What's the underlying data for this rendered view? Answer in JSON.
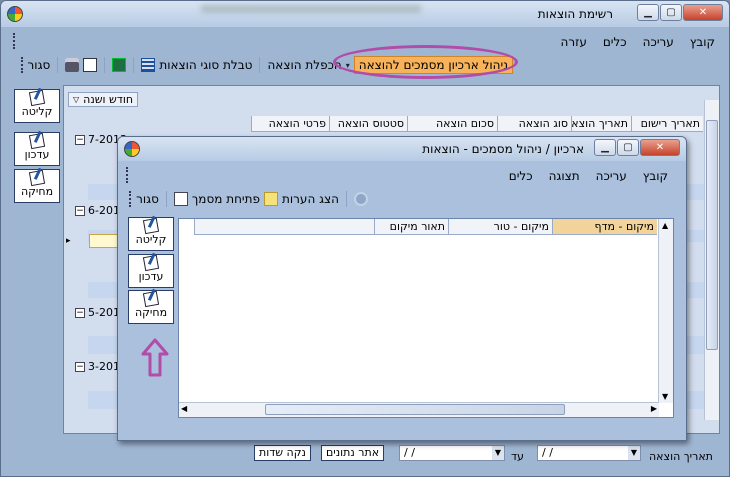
{
  "main_window": {
    "title": "רשימת הוצאות",
    "menu": [
      "קובץ",
      "עריכה",
      "כלים",
      "עזרה"
    ],
    "toolbar": {
      "archive_button": "ניהול ארכיון מסמכים להוצאה",
      "duplicate_button": "הכפלת הוצאה",
      "types_table_button": "טבלת סוגי הוצאות",
      "close_button": "סגור"
    },
    "group_by": "חודש ושנה",
    "columns": [
      "תאריך רישום",
      "תאריך הוצאה",
      "סוג הוצאה",
      "סכום הוצאה",
      "סטטוס הוצאה",
      "פרטי הוצאה"
    ],
    "groups": [
      "7-2013",
      "6-2013",
      "5-2013",
      "3-2013"
    ],
    "side_buttons": [
      "קליטה",
      "עדכון",
      "מחיקה"
    ],
    "bottom": {
      "date_label": "תאריך הוצאה",
      "to_label": "עד",
      "date_from": "/ /",
      "date_to": "/ /",
      "find_button": "אתר נתונים",
      "clear_button": "נקה שדות"
    }
  },
  "dialog": {
    "title": "ארכיון / ניהול מסמכים - הוצאות",
    "menu": [
      "קובץ",
      "עריכה",
      "תצוגה",
      "כלים"
    ],
    "toolbar": {
      "show_notes": "הצג הערות",
      "open_document": "פתיחת מסמך",
      "close_button": "סגור"
    },
    "columns": [
      "מיקום - מדף",
      "מיקום - טור",
      "תאור מיקום"
    ],
    "side_buttons": [
      "קליטה",
      "עדכון",
      "מחיקה"
    ]
  },
  "colors": {
    "highlight": "#f7b25a",
    "annotation": "#b24ca8",
    "band": "#c5d6ee"
  }
}
